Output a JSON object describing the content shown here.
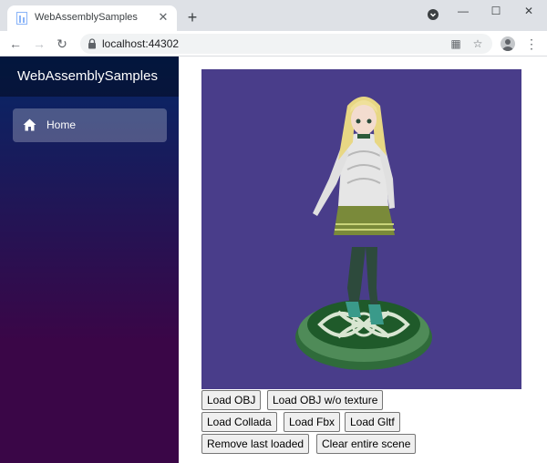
{
  "browser": {
    "tab_title": "WebAssemblySamples",
    "url": "localhost:44302"
  },
  "app": {
    "brand": "WebAssemblySamples",
    "nav": [
      {
        "label": "Home",
        "icon": "home-icon"
      }
    ]
  },
  "scene": {
    "background_color": "#493d8a",
    "buttons": {
      "load_obj": "Load OBJ",
      "load_obj_no_texture": "Load OBJ w/o texture",
      "load_collada": "Load Collada",
      "load_fbx": "Load Fbx",
      "load_gltf": "Load Gltf",
      "remove_last": "Remove last loaded",
      "clear_scene": "Clear entire scene"
    }
  }
}
